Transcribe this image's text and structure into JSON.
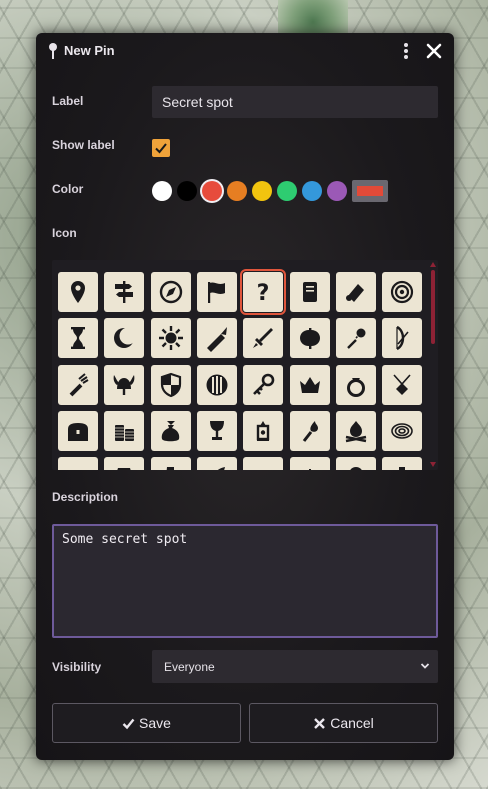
{
  "dialog": {
    "title": "New Pin",
    "label_field": {
      "label": "Label",
      "value": "Secret spot"
    },
    "show_label": {
      "label": "Show label",
      "checked": true
    },
    "color": {
      "label": "Color",
      "swatches": [
        "#ffffff",
        "#000000",
        "#e74c3c",
        "#e67e22",
        "#f1c40f",
        "#2ecc71",
        "#3498db",
        "#9b59b6"
      ],
      "selected": "#e74c3c",
      "custom": "#e24a38"
    },
    "icon": {
      "label": "Icon",
      "selected": "question-mark",
      "rows": [
        [
          "map-marker",
          "signpost",
          "compass",
          "flag",
          "question-mark",
          "scroll",
          "scroll-unfurled",
          "target"
        ],
        [
          "hourglass",
          "crescent-moon",
          "sun",
          "sword-fire",
          "dagger",
          "battle-axe",
          "flail",
          "bow"
        ],
        [
          "quiver",
          "viking-helmet",
          "shield-checkered",
          "round-shield",
          "key",
          "crown",
          "ring",
          "amulet"
        ],
        [
          "treasure-chest",
          "coin-stack",
          "money-bag",
          "chalice",
          "lantern",
          "torch",
          "campfire",
          "rope-coil"
        ],
        [
          "cauldron",
          "barrel",
          "boot",
          "feather",
          "saddle",
          "wheat",
          "tree",
          "potion"
        ]
      ]
    },
    "description": {
      "label": "Description",
      "value": "Some secret spot"
    },
    "visibility": {
      "label": "Visibility",
      "value": "Everyone"
    },
    "buttons": {
      "save": "Save",
      "cancel": "Cancel"
    }
  }
}
